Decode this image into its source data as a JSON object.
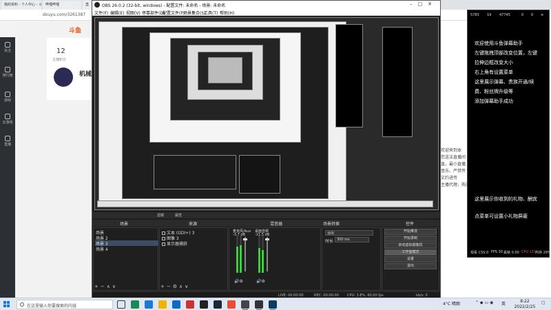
{
  "browser": {
    "tabs": [
      "我的资料 - 个人中心 - 斗鱼",
      "哔哩哔哩",
      "直"
    ],
    "address": "douyu.com/3261387",
    "logo": "斗鱼",
    "side_nav": [
      "关注",
      "排行榜",
      "游戏",
      "云游戏",
      "直播"
    ],
    "card_number": "12",
    "card_sub": "主播积分",
    "mascot_label": "机械",
    "right_page_lines": [
      "欢迎来到本",
      "您送法直播间",
      "直，最小直播",
      "音乐、严禁传",
      "文约进传",
      "主播代理，购买礼物"
    ]
  },
  "obs": {
    "title": "OBS 26.0.2 (32-bit, windows) - 配置文件: 未命名 - 场景: 未命名",
    "menu": [
      "文件(F)",
      "编辑(E)",
      "视图(V)",
      "停靠部件(D)",
      "配置文件(P)",
      "场景集合(S)",
      "工具(T)",
      "帮助(H)"
    ],
    "scene_bar": {
      "filters": "滤镜",
      "props": "属性"
    },
    "docks": {
      "scenes": "场景",
      "sources": "来源",
      "mixer": "混音器",
      "transitions": "场景转换",
      "controls": "控件"
    },
    "scenes": [
      "场景",
      "场景 2",
      "场景 3",
      "场景 4"
    ],
    "selected_scene_index": 2,
    "sources": [
      "文本 (GDI+) 3",
      "图像 3",
      "显示器捕获"
    ],
    "mixer": [
      {
        "name": "麦克风/Aux",
        "db": "-3.7 dB"
      },
      {
        "name": "桌面音频",
        "db": "-11.5 dB"
      }
    ],
    "transition": {
      "type": "淡出",
      "duration_label": "时长",
      "duration": "300 ms"
    },
    "controls": [
      "开始推流",
      "开始录制",
      "启动虚拟摄像机",
      "工作室模式",
      "设置",
      "退出"
    ],
    "active_control_index": 3,
    "status": {
      "live": "LIVE: 00:00:00",
      "rec": "REC: 00:00:00",
      "cpu": "CPU: 3.8%, 60.00 fps",
      "kbps": "kb/s: 0"
    }
  },
  "danmaku": {
    "top": [
      "5783",
      "19",
      "47745",
      "0",
      "0"
    ],
    "lines": [
      "欢迎使用斗鱼弹幕助手",
      "左键拖拽顶部改变位置，左键",
      "拉伸边框改变大小",
      "右上角有设置菜单",
      "这里展示弹幕、贵族开通/续",
      "费、粉丝牌升级等",
      "添加弹幕助手成功",
      "这里展示你收到的礼物、酬宾",
      "点菜单可设置小礼物屏蔽"
    ],
    "footer": {
      "fps": "观看 CSS:0",
      "fps2": "FPS 30",
      "net": "丢帧 0.00",
      "cpu": "CPU 11%",
      "mem": "内存 29%"
    }
  },
  "taskbar": {
    "search_placeholder": "在这里输入你要搜索的内容",
    "weather": "4°C 晴朗",
    "lang": "英",
    "time": "8:22",
    "date": "2022/2/25"
  },
  "colors": {
    "obs_bg": "#1e1e1e",
    "meter_green": "#3bd13b",
    "selection": "#3c4d64",
    "douyu_orange": "#e85a1a"
  }
}
